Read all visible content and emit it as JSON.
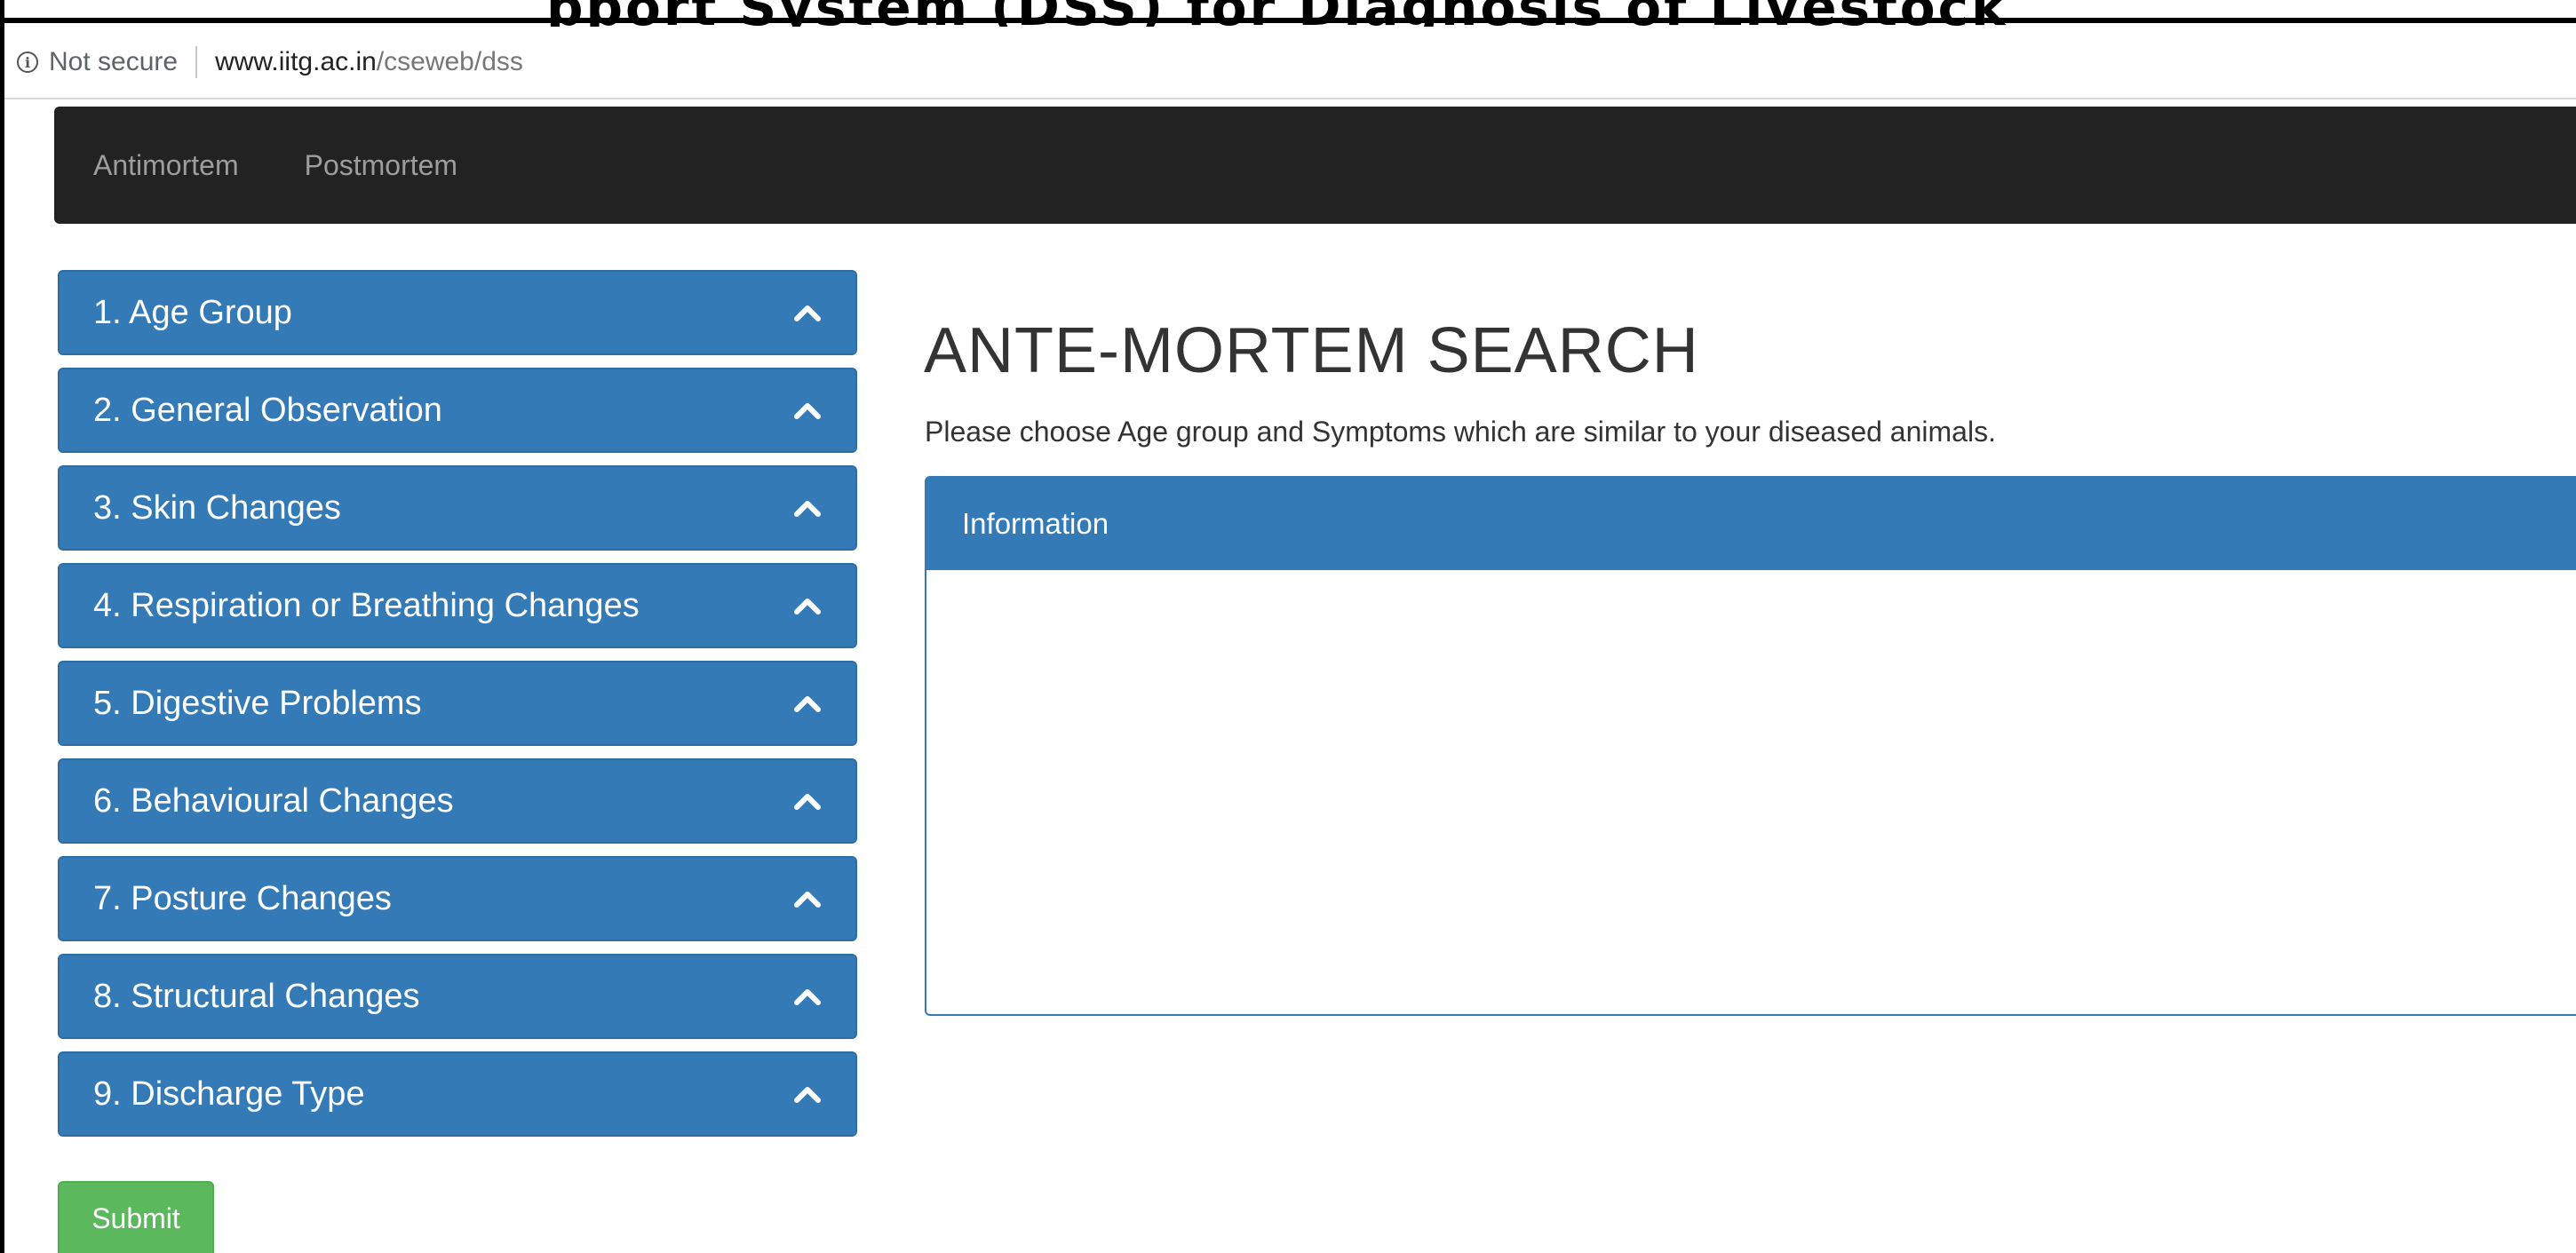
{
  "browser": {
    "security_label": "Not secure",
    "url_host": "www.iitg.ac.in",
    "url_path": "/cseweb/dss",
    "cropped_heading": "pport System (DSS) for Diagnosis of Livestock"
  },
  "navbar": {
    "items": [
      {
        "label": "Antimortem"
      },
      {
        "label": "Postmortem"
      }
    ]
  },
  "sidebar": {
    "items": [
      {
        "label": "1. Age Group",
        "icon": "chevron-up-icon"
      },
      {
        "label": "2. General Observation",
        "icon": "chevron-up-icon"
      },
      {
        "label": "3. Skin Changes",
        "icon": "chevron-up-icon"
      },
      {
        "label": "4. Respiration or Breathing Changes",
        "icon": "chevron-up-icon"
      },
      {
        "label": "5. Digestive Problems",
        "icon": "chevron-up-icon"
      },
      {
        "label": "6. Behavioural Changes",
        "icon": "chevron-up-icon"
      },
      {
        "label": "7. Posture Changes",
        "icon": "chevron-up-icon"
      },
      {
        "label": "8. Structural Changes",
        "icon": "chevron-up-icon"
      },
      {
        "label": "9. Discharge Type",
        "icon": "chevron-up-icon"
      }
    ],
    "submit_label": "Submit"
  },
  "main": {
    "title": "ANTE-MORTEM SEARCH",
    "description": "Please choose Age group and Symptoms which are similar to your diseased animals.",
    "panel_heading": "Information"
  },
  "colors": {
    "accordion": "#337ab7",
    "navbar": "#222222",
    "submit": "#5cb85c"
  }
}
